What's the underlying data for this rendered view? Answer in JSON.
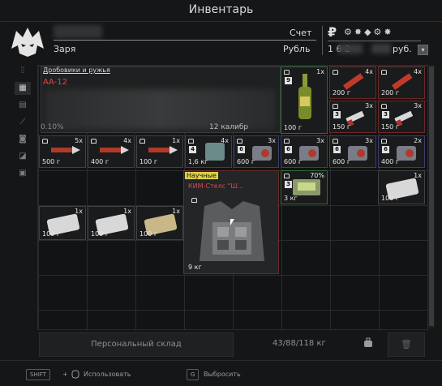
{
  "header": {
    "title": "Инвентарь"
  },
  "player": {
    "name": "Заря",
    "score_label": "Счет",
    "ruble_label": "Рубль"
  },
  "currency": {
    "symbol": "₽",
    "icons": "⚙✸◆⚙✸",
    "amount_partial": "1 6     2",
    "unit": "руб.",
    "dropdown": "▾"
  },
  "tools": [
    "filter-icon",
    "grid-icon",
    "stash-icon",
    "weapon-icon",
    "camera-icon",
    "bag-icon",
    "box-icon"
  ],
  "shotgun": {
    "category": "Дробовики и ружья",
    "name": "АА-12",
    "footer_left": "0.10%",
    "footer_right": "12 калибр"
  },
  "items": [
    {
      "id": "bottle",
      "qty": "1x",
      "weight": "100 г",
      "level": "9"
    },
    {
      "id": "dyn1",
      "qty": "4x",
      "weight": "200 г"
    },
    {
      "id": "dyn2",
      "qty": "4x",
      "weight": "200 г"
    },
    {
      "id": "shell1",
      "qty": "3x",
      "weight": "150 г",
      "level": "3"
    },
    {
      "id": "shell2",
      "qty": "3x",
      "weight": "150 г",
      "level": "3"
    },
    {
      "id": "rocket1",
      "qty": "5x",
      "weight": "500 г"
    },
    {
      "id": "rocket2",
      "qty": "4x",
      "weight": "400 г"
    },
    {
      "id": "rocket3",
      "qty": "1x",
      "weight": "100 г"
    },
    {
      "id": "bag",
      "qty": "4x",
      "weight": "1,6 кг",
      "level": "4"
    },
    {
      "id": "canister1",
      "qty": "3x",
      "weight": "600 г",
      "level": "6"
    },
    {
      "id": "canister2",
      "qty": "3x",
      "weight": "600 г",
      "level": "6"
    },
    {
      "id": "canister3",
      "qty": "3x",
      "weight": "600 г",
      "level": "6"
    },
    {
      "id": "canister4",
      "qty": "2x",
      "weight": "400 г",
      "level": "6"
    },
    {
      "id": "device",
      "qty": "70%",
      "weight": "3 кг",
      "level": "3"
    },
    {
      "id": "pack1",
      "qty": "1x",
      "weight": "100 г"
    },
    {
      "id": "pack2",
      "qty": "1x",
      "weight": "100 г"
    },
    {
      "id": "pack3",
      "qty": "1x",
      "weight": "100 г"
    },
    {
      "id": "pack4",
      "qty": "1x",
      "weight": "100 г"
    }
  ],
  "vest": {
    "tag": "Научные",
    "name": "КИМ-Стелс \"Ш...",
    "weight": "9 кг"
  },
  "bottom": {
    "stash_label": "Персональный склад",
    "weight": "43/88/118 кг",
    "trash": "🗑"
  },
  "hints": {
    "shift": "SHIFT",
    "plus": "+",
    "use": "Использовать",
    "g": "G",
    "drop": "Выбросить"
  }
}
